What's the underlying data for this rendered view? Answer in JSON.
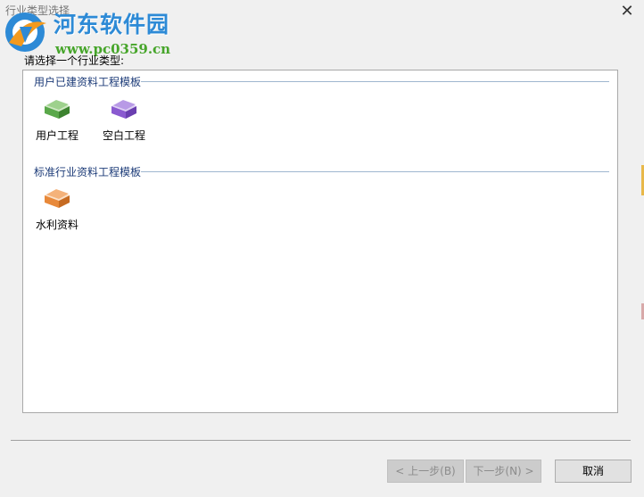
{
  "window": {
    "title": "行业类型选择",
    "close_symbol": "✕"
  },
  "watermark": {
    "title": "河东软件园",
    "url": "www.pc0359.cn"
  },
  "prompt": "请选择一个行业类型:",
  "groups": [
    {
      "title": "用户已建资料工程模板",
      "items": [
        {
          "label": "用户工程",
          "icon": "green-folder-icon",
          "color": "#5aa84a"
        },
        {
          "label": "空白工程",
          "icon": "purple-folder-icon",
          "color": "#8a5ad0"
        }
      ]
    },
    {
      "title": "标准行业资料工程模板",
      "items": [
        {
          "label": "水利资料",
          "icon": "orange-folder-icon",
          "color": "#e8893a"
        }
      ]
    }
  ],
  "buttons": {
    "prev": "< 上一步(B)",
    "next": "下一步(N) >",
    "cancel": "取消"
  }
}
